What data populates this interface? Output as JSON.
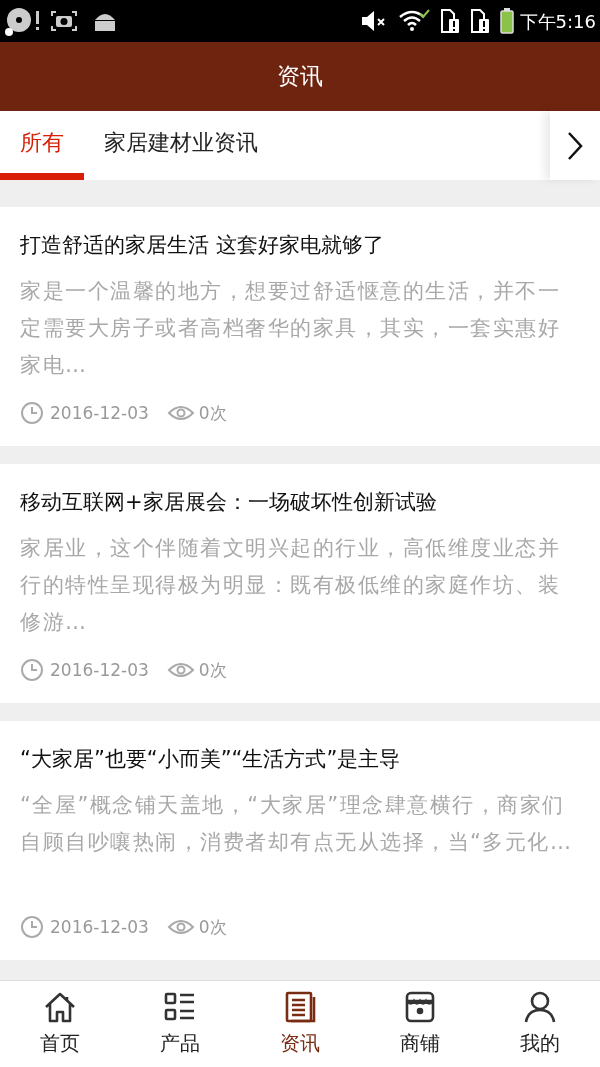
{
  "status_bar": {
    "time": "下午5:16"
  },
  "header": {
    "title": "资讯"
  },
  "tabs": [
    {
      "label": "所有",
      "selected": true
    },
    {
      "label": "家居建材业资讯",
      "selected": false
    }
  ],
  "articles": [
    {
      "title": "打造舒适的家居生活 这套好家电就够了",
      "summary": "家是一个温馨的地方，想要过舒适惬意的生活，并不一定需要大房子或者高档奢华的家具，其实，一套实惠好家电…",
      "date": "2016-12-03",
      "views": "0次"
    },
    {
      "title": "移动互联网+家居展会：一场破坏性创新试验",
      "summary": "家居业，这个伴随着文明兴起的行业，高低维度业态并行的特性呈现得极为明显：既有极低维的家庭作坊、装修游…",
      "date": "2016-12-03",
      "views": "0次"
    },
    {
      "title": "“大家居”也要“小而美”“生活方式”是主导",
      "summary": "“全屋”概念铺天盖地，“大家居”理念肆意横行，商家们自顾自吵嚷热闹，消费者却有点无从选择，当“多元化…",
      "date": "2016-12-03",
      "views": "0次"
    }
  ],
  "bottom_nav": [
    {
      "kind": "home",
      "label": "首页",
      "selected": false
    },
    {
      "kind": "list",
      "label": "产品",
      "selected": false
    },
    {
      "kind": "news",
      "label": "资讯",
      "selected": true
    },
    {
      "kind": "shop",
      "label": "商铺",
      "selected": false
    },
    {
      "kind": "user",
      "label": "我的",
      "selected": false
    }
  ]
}
